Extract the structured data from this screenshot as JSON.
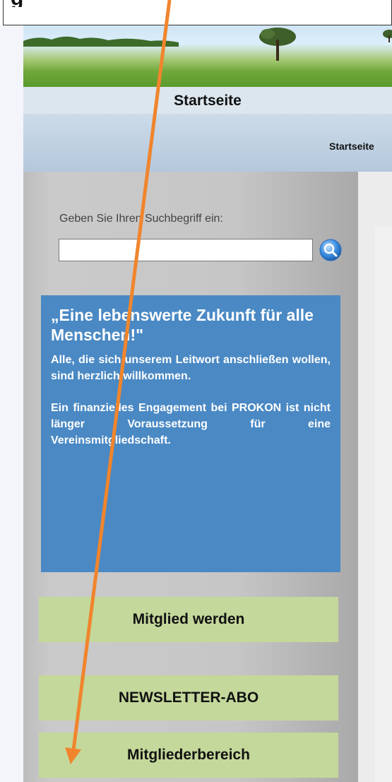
{
  "header": {
    "page_title": "Startseite",
    "breadcrumb": "Startseite"
  },
  "search": {
    "label": "Geben Sie Ihren Suchbegriff ein:",
    "value": "",
    "placeholder": "",
    "button_icon": "magnifier-icon"
  },
  "quote_box": {
    "headline": "„Eine lebenswerte Zukunft für alle Menschen!\"",
    "paragraph1": "Alle, die sich unserem Leitwort anschließen wollen, sind herzlich willkommen.",
    "paragraph2": "Ein finanzielles Engagement bei PROKON ist nicht länger Voraussetzung für eine Vereinsmitgliedschaft."
  },
  "sidebar_buttons": [
    {
      "label": "Mitglied werden"
    },
    {
      "label": "NEWSLETTER-ABO"
    },
    {
      "label": "Mitgliederbereich"
    }
  ],
  "colors": {
    "quote_box_bg": "#4a89c4",
    "button_bg": "#c4d89b",
    "annotation_arrow": "#f0852d"
  }
}
